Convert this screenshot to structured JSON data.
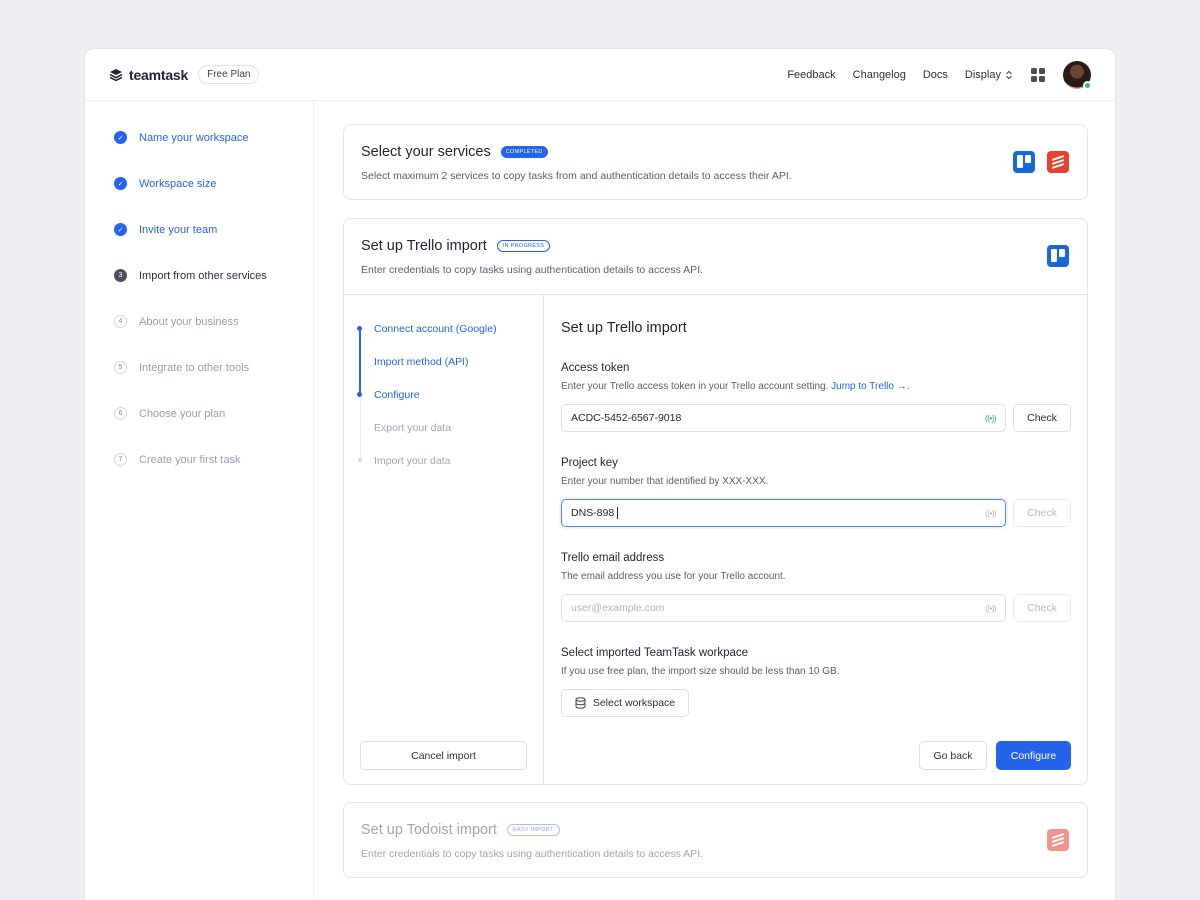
{
  "header": {
    "brand": "teamtask",
    "plan": "Free Plan",
    "nav": [
      "Feedback",
      "Changelog",
      "Docs"
    ],
    "display_label": "Display"
  },
  "sidebar": {
    "steps": [
      {
        "num": "✓",
        "label": "Name your workspace",
        "state": "done"
      },
      {
        "num": "✓",
        "label": "Workspace size",
        "state": "done"
      },
      {
        "num": "✓",
        "label": "Invite your team",
        "state": "done"
      },
      {
        "num": "3",
        "label": "Import from other services",
        "state": "current"
      },
      {
        "num": "4",
        "label": "About your business",
        "state": "todo"
      },
      {
        "num": "5",
        "label": "Integrate to other tools",
        "state": "todo"
      },
      {
        "num": "6",
        "label": "Choose your plan",
        "state": "todo"
      },
      {
        "num": "7",
        "label": "Create your first task",
        "state": "todo"
      }
    ]
  },
  "services_card": {
    "title": "Select your services",
    "badge": "COMPLETED",
    "description": "Select maximum 2 services to copy tasks from and authentication details to access their API."
  },
  "trello_card": {
    "title": "Set up Trello import",
    "badge": "IN PROGRESS",
    "description": "Enter credentials to copy tasks using authentication details to access API.",
    "substeps": [
      "Connect account (Google)",
      "Import method (API)",
      "Configure",
      "Export your data",
      "Import your data"
    ],
    "cancel_label": "Cancel import"
  },
  "form": {
    "title": "Set up Trello import",
    "access_token": {
      "label": "Access token",
      "help": "Enter your Trello access token in your Trello account setting.",
      "help_link": "Jump to Trello →",
      "value": "ACDC-5452-6567-9018",
      "signal": "((•))",
      "check": "Check"
    },
    "project_key": {
      "label": "Project key",
      "help": "Enter your number that identified by XXX-XXX.",
      "value": "DNS-898",
      "signal": "((•))",
      "check": "Check"
    },
    "email": {
      "label": "Trello email address",
      "help": "The email address you use for your Trello account.",
      "placeholder": "user@example.com",
      "signal": "((•))",
      "check": "Check"
    },
    "workspace": {
      "label": "Select imported TeamTask workpace",
      "help": "If you use free plan, the import size should be less than 10 GB.",
      "button": "Select workspace"
    },
    "back_label": "Go back",
    "configure_label": "Configure"
  },
  "todoist_card": {
    "title": "Set up Todoist import",
    "badge": "EASY IMPORT",
    "description": "Enter credentials to copy tasks using authentication details to access API."
  },
  "colors": {
    "accent": "#2563eb",
    "trello": "#1868db",
    "todoist": "#e44232",
    "online": "#22c55e"
  }
}
